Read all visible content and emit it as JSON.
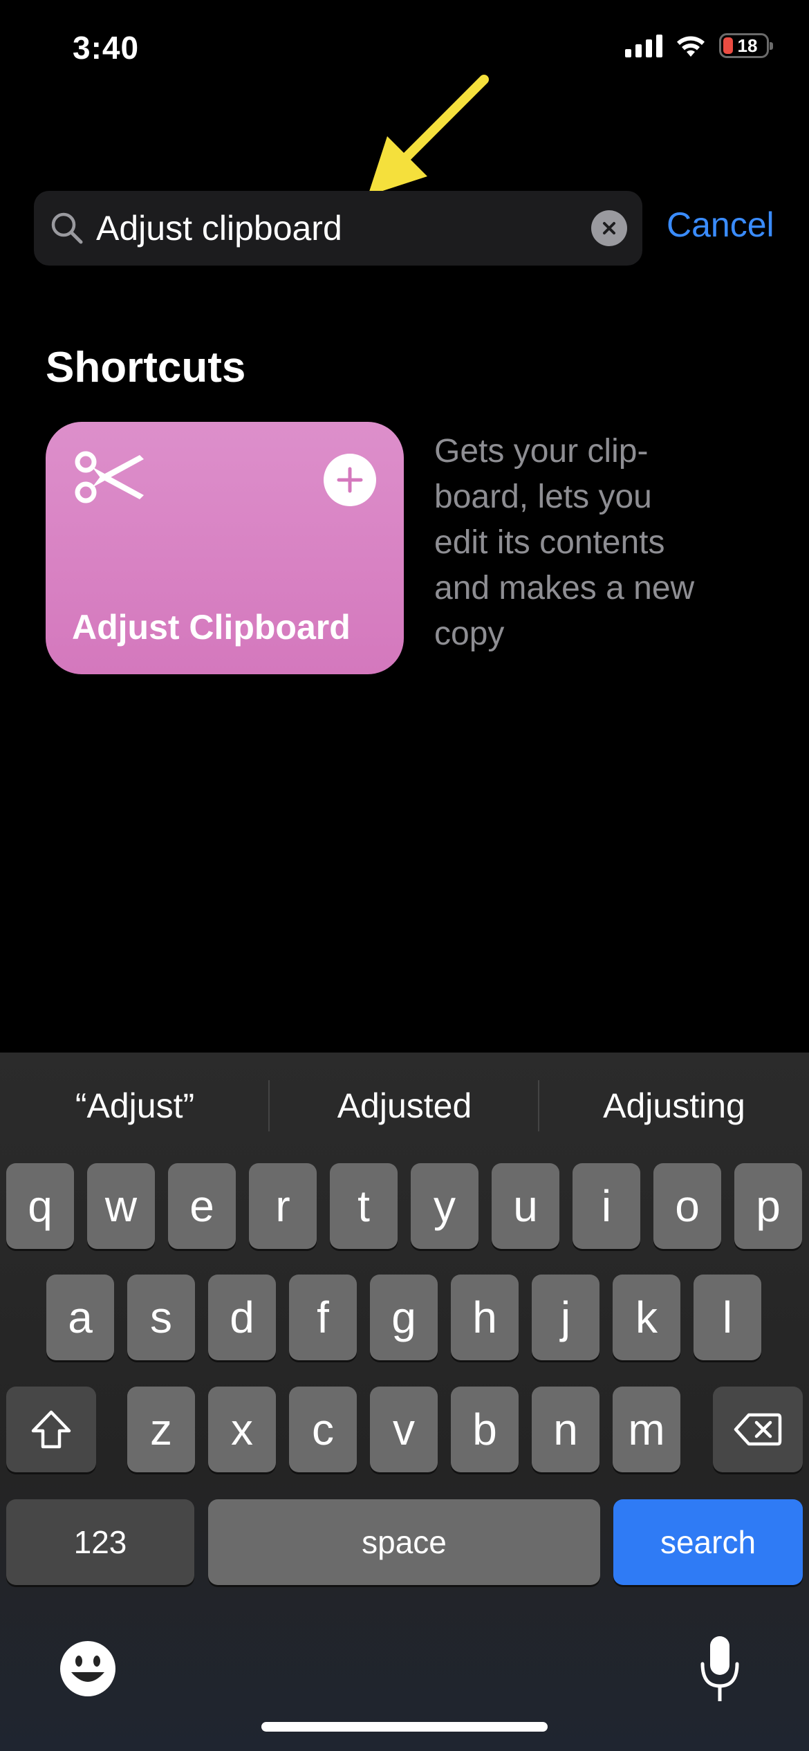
{
  "status_bar": {
    "time": "3:40",
    "battery": "18"
  },
  "search": {
    "value": "Adjust clipboard",
    "cancel_label": "Cancel"
  },
  "section": {
    "title": "Shortcuts"
  },
  "shortcut": {
    "name": "Adjust Clipboard",
    "description_lines": [
      "Gets your clip-",
      "board, lets you",
      "edit its contents",
      "and makes a new",
      "copy"
    ],
    "color": "#d883c4"
  },
  "keyboard": {
    "suggestions": [
      "“Adjust”",
      "Adjusted",
      "Adjusting"
    ],
    "row1": [
      "q",
      "w",
      "e",
      "r",
      "t",
      "y",
      "u",
      "i",
      "o",
      "p"
    ],
    "row2": [
      "a",
      "s",
      "d",
      "f",
      "g",
      "h",
      "j",
      "k",
      "l"
    ],
    "row3": [
      "z",
      "x",
      "c",
      "v",
      "b",
      "n",
      "m"
    ],
    "numbers_label": "123",
    "space_label": "space",
    "search_label": "search"
  },
  "colors": {
    "accent": "#3a8cff",
    "search_key": "#2f7bf5",
    "annotation": "#f5e03c"
  }
}
